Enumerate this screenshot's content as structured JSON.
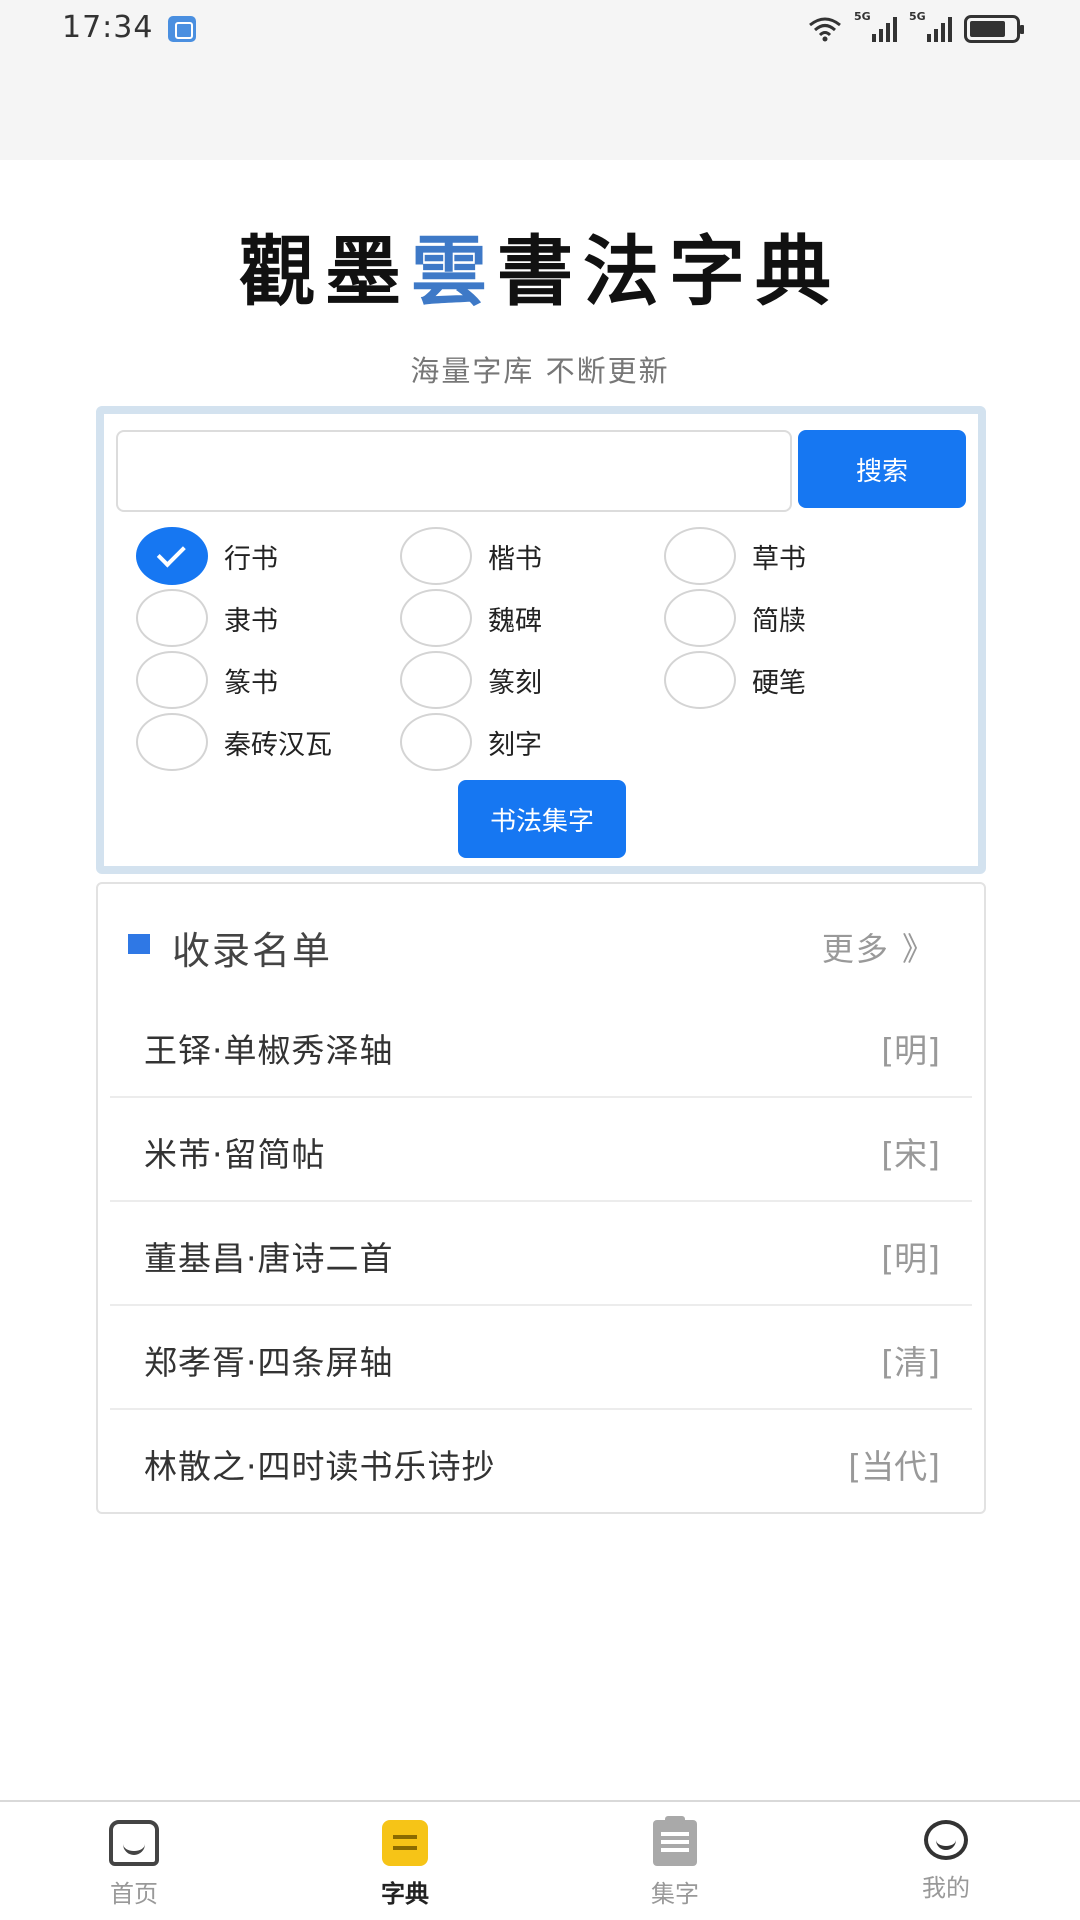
{
  "status_bar": {
    "time": "17:34",
    "network_1": "5G",
    "network_2": "5G",
    "battery_level": 0.8
  },
  "header": {
    "logo_text_a": "觀墨",
    "logo_text_b": "雲",
    "logo_text_c": "書法字典",
    "subtitle": "海量字库 不断更新"
  },
  "search": {
    "input_value": "",
    "placeholder": "",
    "button_label": "搜索",
    "options": [
      {
        "label": "行书",
        "checked": true
      },
      {
        "label": "楷书",
        "checked": false
      },
      {
        "label": "草书",
        "checked": false
      },
      {
        "label": "隶书",
        "checked": false
      },
      {
        "label": "魏碑",
        "checked": false
      },
      {
        "label": "简牍",
        "checked": false
      },
      {
        "label": "篆书",
        "checked": false
      },
      {
        "label": "篆刻",
        "checked": false
      },
      {
        "label": "硬笔",
        "checked": false
      },
      {
        "label": "秦砖汉瓦",
        "checked": false
      },
      {
        "label": "刻字",
        "checked": false
      }
    ],
    "collect_button_label": "书法集字"
  },
  "collection": {
    "title": "收录名单",
    "more_label": "更多 》",
    "items": [
      {
        "title": "王铎·单椒秀泽轴",
        "dynasty": "[明]"
      },
      {
        "title": "米芾·留简帖",
        "dynasty": "[宋]"
      },
      {
        "title": "董基昌·唐诗二首",
        "dynasty": "[明]"
      },
      {
        "title": "郑孝胥·四条屏轴",
        "dynasty": "[清]"
      },
      {
        "title": "林散之·四时读书乐诗抄",
        "dynasty": "[当代]"
      }
    ]
  },
  "bottom_nav": {
    "items": [
      {
        "label": "首页",
        "icon": "home-icon",
        "active": false
      },
      {
        "label": "字典",
        "icon": "dictionary-icon",
        "active": true
      },
      {
        "label": "集字",
        "icon": "clipboard-icon",
        "active": false
      },
      {
        "label": "我的",
        "icon": "profile-icon",
        "active": false
      }
    ]
  },
  "colors": {
    "primary": "#1677f2",
    "panel_border": "#d3e2ef",
    "dictionary_icon": "#f6c417"
  }
}
